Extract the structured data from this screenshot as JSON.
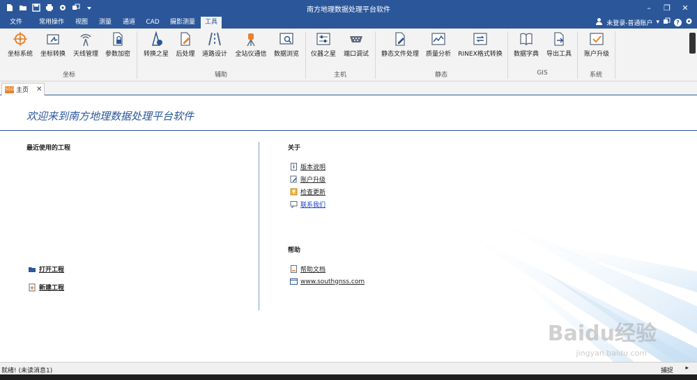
{
  "app": {
    "title": "南方地理数据处理平台软件"
  },
  "quick_access": {
    "icons": [
      "new-file-icon",
      "open-folder-icon",
      "save-icon",
      "print-icon",
      "settings-icon",
      "window-switch-icon",
      "dropdown-icon"
    ]
  },
  "window_controls": {
    "minimize": "–",
    "restore": "❐",
    "close": "✕"
  },
  "menu": {
    "items": [
      "文件",
      "常用操作",
      "视图",
      "测量",
      "通道",
      "CAD",
      "摄影测量",
      "工具"
    ],
    "active": "工具"
  },
  "user": {
    "label": "未登录-普通账户",
    "caret": "▾",
    "help": "?"
  },
  "ribbon": {
    "groups": [
      {
        "label": "坐标",
        "buttons": [
          "坐标系统",
          "坐标转换",
          "天线管理",
          "参数加密"
        ]
      },
      {
        "label": "辅助",
        "buttons": [
          "转换之星",
          "后处理",
          "道路设计",
          "全站仪通信",
          "数据浏览"
        ]
      },
      {
        "label": "主机",
        "buttons": [
          "仪器之星",
          "端口调试"
        ]
      },
      {
        "label": "静态",
        "buttons": [
          "静态文件处理",
          "质量分析",
          "RINEX格式转换"
        ]
      },
      {
        "label": "GIS",
        "buttons": [
          "数据字典",
          "导出工具"
        ]
      },
      {
        "label": "系统",
        "buttons": [
          "账户升级"
        ]
      }
    ]
  },
  "doc_tab": {
    "label": "主页",
    "close": "✕",
    "icon_text": "SGG"
  },
  "home": {
    "welcome": "欢迎来到南方地理数据处理平台软件",
    "recent_title": "最近使用的工程",
    "about_title": "关于",
    "about_links": [
      "版本说明",
      "账户升级",
      "检查更新",
      "联系我们"
    ],
    "help_title": "帮助",
    "help_links": [
      "帮助文档",
      "www.southgnss.com"
    ],
    "open_project": "打开工程",
    "new_project": "新建工程"
  },
  "watermark": {
    "main": "Baidu经验",
    "sub": "jingyan.baidu.com"
  },
  "status": {
    "left": "就绪!  (未读消息1)",
    "right": "捕捉",
    "arrow": "▸"
  },
  "colors": {
    "accent": "#2b579a",
    "ribbon_bg": "#f3f3f3",
    "link_blue": "#1a3fcf"
  }
}
